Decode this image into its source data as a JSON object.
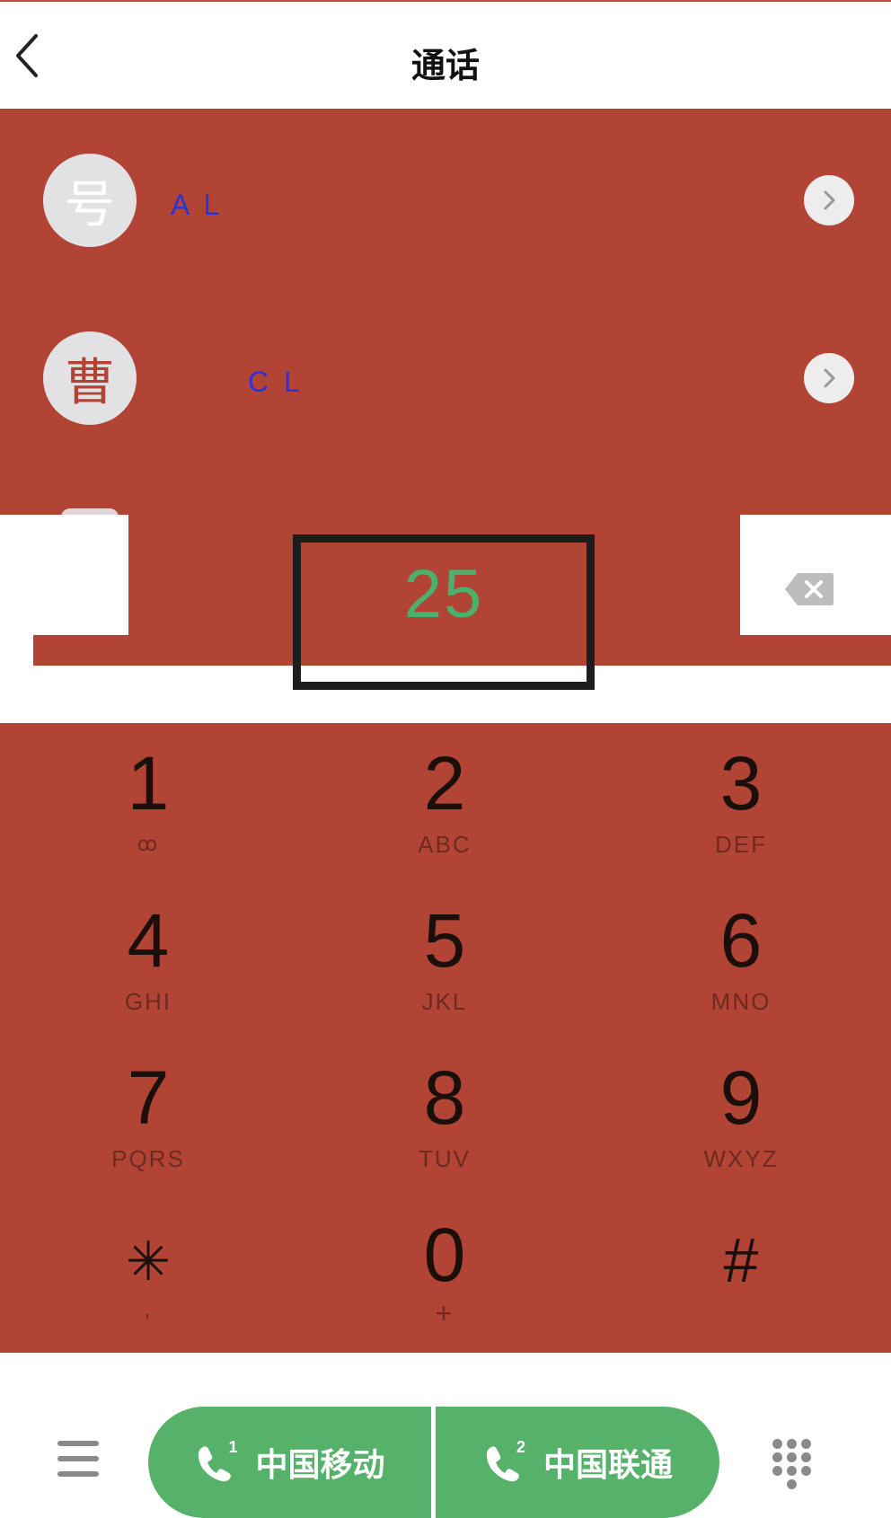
{
  "header": {
    "title": "通话",
    "back_icon": "chevron-left-icon"
  },
  "contacts": [
    {
      "avatar_text": "号",
      "name": "A L",
      "chevron_icon": "chevron-right-icon"
    },
    {
      "avatar_text": "曹",
      "name": "C   L",
      "chevron_icon": "chevron-right-icon"
    }
  ],
  "dialer": {
    "number": "25",
    "delete_icon": "backspace-icon"
  },
  "keypad": {
    "keys": [
      {
        "digit": "1",
        "letters": "ꝏ"
      },
      {
        "digit": "2",
        "letters": "ABC"
      },
      {
        "digit": "3",
        "letters": "DEF"
      },
      {
        "digit": "4",
        "letters": "GHI"
      },
      {
        "digit": "5",
        "letters": "JKL"
      },
      {
        "digit": "6",
        "letters": "MNO"
      },
      {
        "digit": "7",
        "letters": "PQRS"
      },
      {
        "digit": "8",
        "letters": "TUV"
      },
      {
        "digit": "9",
        "letters": "WXYZ"
      },
      {
        "digit": "✳",
        "letters": ","
      },
      {
        "digit": "0",
        "letters": "+"
      },
      {
        "digit": "#",
        "letters": ""
      }
    ]
  },
  "bottom_bar": {
    "menu_icon": "menu-icon",
    "sim1": {
      "label": "中国移动",
      "slot": "1",
      "icon": "phone-icon"
    },
    "sim2": {
      "label": "中国联通",
      "slot": "2",
      "icon": "phone-icon"
    },
    "dialpad_icon": "dialpad-icon"
  },
  "colors": {
    "overlay_red": "#b14434",
    "call_green": "#56b26a",
    "number_green": "#4caf6b",
    "name_blue": "#2a33d6"
  }
}
